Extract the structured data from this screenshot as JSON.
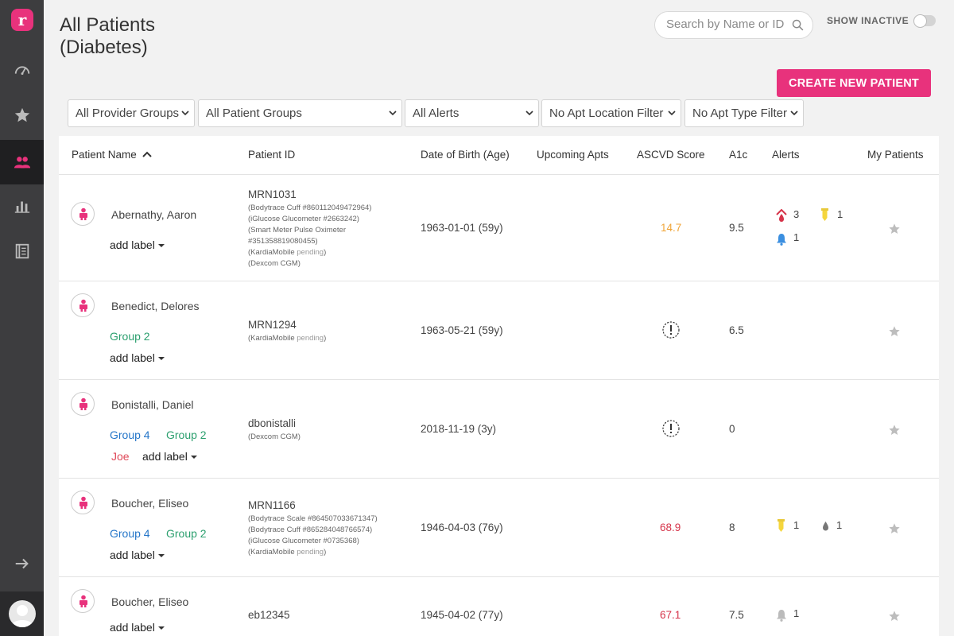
{
  "sidebar": {
    "logo": "r",
    "items": [
      {
        "icon": "dashboard-gauge-icon"
      },
      {
        "icon": "star-icon"
      },
      {
        "icon": "patients-icon",
        "active": true
      },
      {
        "icon": "bar-chart-icon"
      },
      {
        "icon": "notebook-icon"
      }
    ],
    "collapse_icon": "arrow-right-icon"
  },
  "header": {
    "title_line1": "All Patients",
    "title_line2": "(Diabetes)",
    "search_placeholder": "Search by Name or ID",
    "show_inactive": "SHOW INACTIVE",
    "create_button": "CREATE NEW PATIENT"
  },
  "filters": [
    "All Provider Groups",
    "All Patient Groups",
    "All Alerts",
    "No Apt Location Filter",
    "No Apt Type Filter"
  ],
  "columns": {
    "name": "Patient Name",
    "id": "Patient ID",
    "dob": "Date of Birth (Age)",
    "apts": "Upcoming Apts",
    "ascvd": "ASCVD Score",
    "a1c": "A1c",
    "alerts": "Alerts",
    "mine": "My Patients"
  },
  "add_label": "add label",
  "pending": "pending",
  "rows": [
    {
      "name": "Abernathy, Aaron",
      "id": "MRN1031",
      "devices": [
        {
          "text": "(Bodytrace Cuff #860112049472964)"
        },
        {
          "text": "(iGlucose Glucometer #2663242)"
        },
        {
          "text": "(Smart Meter Pulse Oximeter"
        },
        {
          "text": "#351358819080455)"
        },
        {
          "text": "(KardiaMobile ",
          "pending": true
        },
        {
          "text": "(Dexcom CGM)"
        }
      ],
      "dob": "1963-01-01 (59y)",
      "ascvd": "14.7",
      "a1c": "9.5",
      "alerts": {
        "bp": "3",
        "glucose": "1",
        "bell": "1"
      }
    },
    {
      "name": "Benedict, Delores",
      "id": "MRN1294",
      "groups": [
        "Group 2"
      ],
      "devices": [
        {
          "text": "(KardiaMobile ",
          "pending": true
        }
      ],
      "dob": "1963-05-21 (59y)",
      "a1c": "6.5"
    },
    {
      "name": "Bonistalli, Daniel",
      "id": "dbonistalli",
      "groups": [
        "Group 4",
        "Group 2",
        "Joe"
      ],
      "devices": [
        {
          "text": "(Dexcom CGM)"
        }
      ],
      "dob": "2018-11-19 (3y)",
      "a1c": "0"
    },
    {
      "name": "Boucher, Eliseo",
      "id": "MRN1166",
      "groups": [
        "Group 4",
        "Group 2"
      ],
      "devices": [
        {
          "text": "(Bodytrace Scale #864507033671347)"
        },
        {
          "text": "(Bodytrace Cuff #865284048766574)"
        },
        {
          "text": "(iGlucose Glucometer #0735368)"
        },
        {
          "text": "(KardiaMobile ",
          "pending": true
        }
      ],
      "dob": "1946-04-03 (76y)",
      "ascvd": "68.9",
      "a1c": "8",
      "alerts": {
        "glucose": "1",
        "drop": "1"
      }
    },
    {
      "name": "Boucher, Eliseo",
      "id": "eb12345",
      "dob": "1945-04-02 (77y)",
      "ascvd": "67.1",
      "a1c": "7.5",
      "alerts": {
        "bell": "1"
      }
    }
  ]
}
